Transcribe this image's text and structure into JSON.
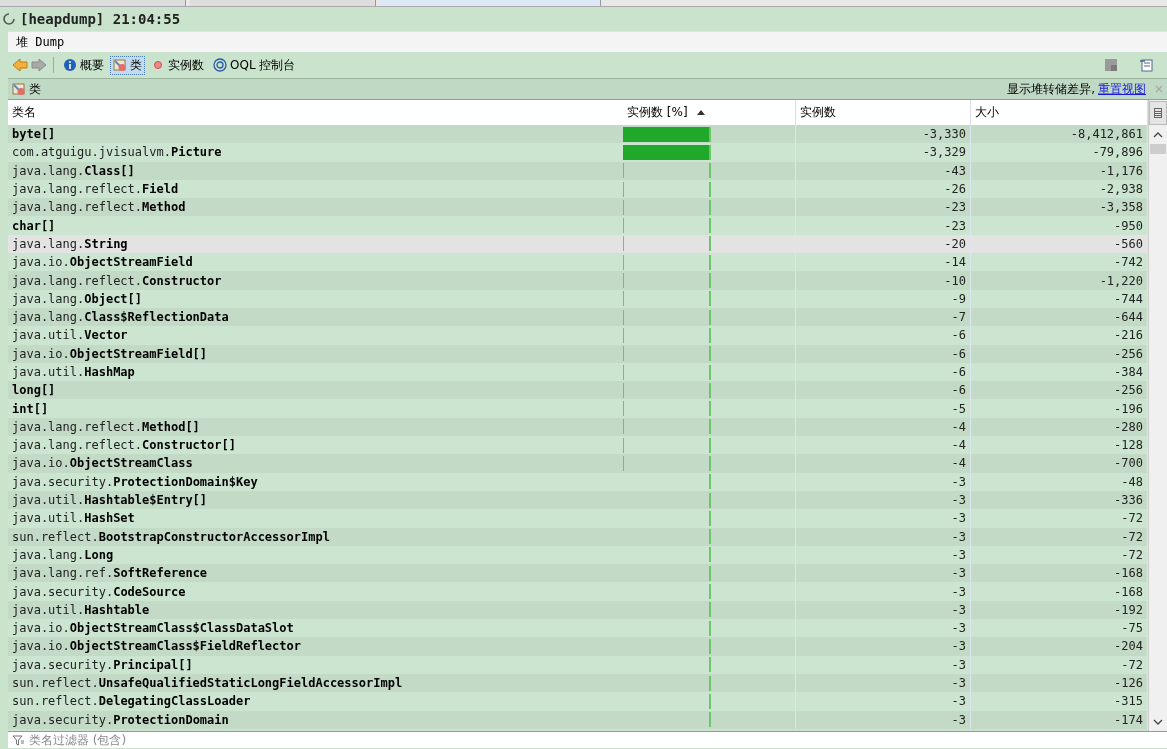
{
  "document_tabs": [
    {
      "selected": false
    },
    {
      "selected": false
    },
    {
      "selected": true
    }
  ],
  "title": "[heapdump] 21:04:55",
  "subtitle": "堆 Dump",
  "toolbar": {
    "views": [
      {
        "label": "概要",
        "kind": "info",
        "selected": false
      },
      {
        "label": "类",
        "kind": "classes",
        "selected": true
      },
      {
        "label": "实例数",
        "kind": "instances",
        "selected": false
      },
      {
        "label": "OQL 控制台",
        "kind": "oql",
        "selected": false
      }
    ]
  },
  "section": {
    "title": "类",
    "note": "显示堆转储差异,",
    "link": "重置视图"
  },
  "table": {
    "columns": [
      {
        "label": "类名",
        "sorted": false
      },
      {
        "label": "实例数 [%]",
        "sorted": true
      },
      {
        "label": "实例数",
        "sorted": false
      },
      {
        "label": "大小",
        "sorted": false
      }
    ],
    "rows": [
      {
        "name": "**byte[]**",
        "level": 1,
        "count": "-3,330",
        "size": "-8,412,861",
        "selected": false
      },
      {
        "name": "com.atguigu.jvisualvm.**Picture**",
        "level": 0.9997,
        "count": "-3,329",
        "size": "-79,896",
        "selected": false
      },
      {
        "name": "java.lang.**Class[]**",
        "level": 0.0129,
        "count": "-43",
        "size": "-1,176",
        "selected": false
      },
      {
        "name": "java.lang.reflect.**Field**",
        "level": 0.0078,
        "count": "-26",
        "size": "-2,938",
        "selected": false
      },
      {
        "name": "java.lang.reflect.**Method**",
        "level": 0.0069,
        "count": "-23",
        "size": "-3,358",
        "selected": false
      },
      {
        "name": "**char[]**",
        "level": 0.0069,
        "count": "-23",
        "size": "-950",
        "selected": false
      },
      {
        "name": "java.lang.**String**",
        "level": 0.006,
        "count": "-20",
        "size": "-560",
        "selected": true
      },
      {
        "name": "java.io.**ObjectStreamField**",
        "level": 0.0042,
        "count": "-14",
        "size": "-742",
        "selected": false
      },
      {
        "name": "java.lang.reflect.**Constructor**",
        "level": 0.003,
        "count": "-10",
        "size": "-1,220",
        "selected": false
      },
      {
        "name": "java.lang.**Object[]**",
        "level": 0.0027,
        "count": "-9",
        "size": "-744",
        "selected": false
      },
      {
        "name": "java.lang.**Class$ReflectionData**",
        "level": 0.0021,
        "count": "-7",
        "size": "-644",
        "selected": false
      },
      {
        "name": "java.util.**Vector**",
        "level": 0.0018,
        "count": "-6",
        "size": "-216",
        "selected": false
      },
      {
        "name": "java.io.**ObjectStreamField[]**",
        "level": 0.0018,
        "count": "-6",
        "size": "-256",
        "selected": false
      },
      {
        "name": "java.util.**HashMap**",
        "level": 0.0018,
        "count": "-6",
        "size": "-384",
        "selected": false
      },
      {
        "name": "**long[]**",
        "level": 0.0018,
        "count": "-6",
        "size": "-256",
        "selected": false
      },
      {
        "name": "**int[]**",
        "level": 0.0015,
        "count": "-5",
        "size": "-196",
        "selected": false
      },
      {
        "name": "java.lang.reflect.**Method[]**",
        "level": 0.0012,
        "count": "-4",
        "size": "-280",
        "selected": false
      },
      {
        "name": "java.lang.reflect.**Constructor[]**",
        "level": 0.0012,
        "count": "-4",
        "size": "-128",
        "selected": false
      },
      {
        "name": "java.io.**ObjectStreamClass**",
        "level": 0.0012,
        "count": "-4",
        "size": "-700",
        "selected": false
      },
      {
        "name": "java.security.**ProtectionDomain$Key**",
        "level": 0.0009,
        "count": "-3",
        "size": "-48",
        "selected": false
      },
      {
        "name": "java.util.**Hashtable$Entry[]**",
        "level": 0.0009,
        "count": "-3",
        "size": "-336",
        "selected": false
      },
      {
        "name": "java.util.**HashSet**",
        "level": 0.0009,
        "count": "-3",
        "size": "-72",
        "selected": false
      },
      {
        "name": "sun.reflect.**BootstrapConstructorAccessorImpl**",
        "level": 0.0009,
        "count": "-3",
        "size": "-72",
        "selected": false
      },
      {
        "name": "java.lang.**Long**",
        "level": 0.0009,
        "count": "-3",
        "size": "-72",
        "selected": false
      },
      {
        "name": "java.lang.ref.**SoftReference**",
        "level": 0.0009,
        "count": "-3",
        "size": "-168",
        "selected": false
      },
      {
        "name": "java.security.**CodeSource**",
        "level": 0.0009,
        "count": "-3",
        "size": "-168",
        "selected": false
      },
      {
        "name": "java.util.**Hashtable**",
        "level": 0.0009,
        "count": "-3",
        "size": "-192",
        "selected": false
      },
      {
        "name": "java.io.**ObjectStreamClass$ClassDataSlot**",
        "level": 0.0009,
        "count": "-3",
        "size": "-75",
        "selected": false
      },
      {
        "name": "java.io.**ObjectStreamClass$FieldReflector**",
        "level": 0.0009,
        "count": "-3",
        "size": "-204",
        "selected": false
      },
      {
        "name": "java.security.**Principal[]**",
        "level": 0.0009,
        "count": "-3",
        "size": "-72",
        "selected": false
      },
      {
        "name": "sun.reflect.**UnsafeQualifiedStaticLongFieldAccessorImpl**",
        "level": 0.0009,
        "count": "-3",
        "size": "-126",
        "selected": false
      },
      {
        "name": "sun.reflect.**DelegatingClassLoader**",
        "level": 0.0009,
        "count": "-3",
        "size": "-315",
        "selected": false
      },
      {
        "name": "java.security.**ProtectionDomain**",
        "level": 0.0009,
        "count": "-3",
        "size": "-174",
        "selected": false
      }
    ]
  },
  "filter": {
    "placeholder": "类名过滤器 (包含)"
  }
}
